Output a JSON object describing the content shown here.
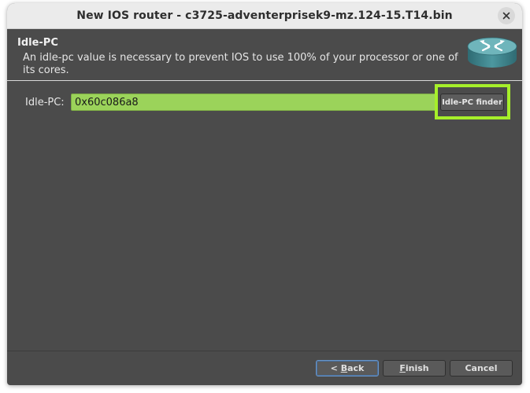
{
  "window": {
    "title": "New IOS router - c3725-adventerprisek9-mz.124-15.T14.bin"
  },
  "header": {
    "title": "Idle-PC",
    "description": "An idle-pc value is necessary to prevent IOS to use 100% of your processor or one of its cores.",
    "icon": "router-icon"
  },
  "form": {
    "idlepc_label": "Idle-PC:",
    "idlepc_value": "0x60c086a8",
    "finder_label": "Idle-PC finder"
  },
  "footer": {
    "back_mnemonic": "B",
    "back_rest": "ack",
    "back_prefix": "< ",
    "finish_mnemonic": "F",
    "finish_rest": "inish",
    "cancel_label": "Cancel"
  },
  "colors": {
    "dialog_bg": "#4b4b4b",
    "input_highlight": "#9bd35a",
    "finder_highlight": "#a6ef2a",
    "router_teal": "#4e9aa1"
  }
}
